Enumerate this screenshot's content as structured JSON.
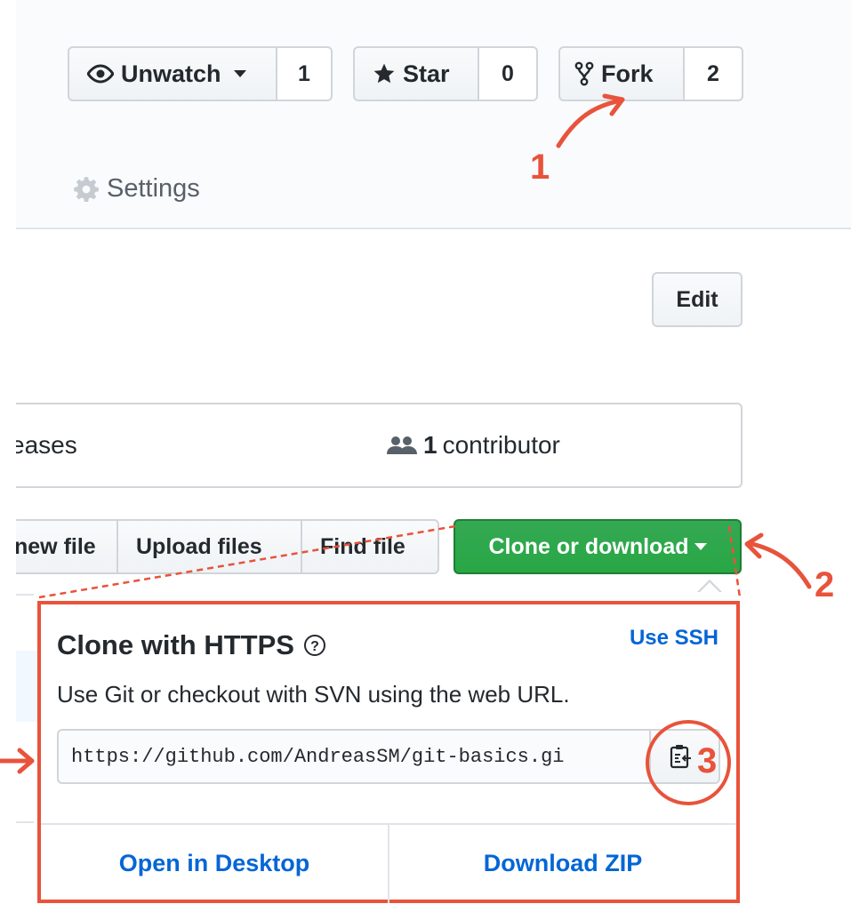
{
  "repo_actions": {
    "watch": {
      "label": "Unwatch",
      "count": "1"
    },
    "star": {
      "label": "Star",
      "count": "0"
    },
    "fork": {
      "label": "Fork",
      "count": "2"
    }
  },
  "tabs": {
    "settings": "Settings"
  },
  "edit_label": "Edit",
  "summary": {
    "releases": "eases",
    "contributor_count": "1",
    "contributor_label": "contributor"
  },
  "file_buttons": {
    "new_file": "new file",
    "upload": "Upload files",
    "find": "Find file"
  },
  "clone_button": "Clone or download",
  "clone_popup": {
    "title": "Clone with HTTPS",
    "use_ssh": "Use SSH",
    "description": "Use Git or checkout with SVN using the web URL.",
    "url": "https://github.com/AndreasSM/git-basics.gi",
    "open_desktop": "Open in Desktop",
    "download_zip": "Download ZIP"
  },
  "annotations": {
    "step1": "1",
    "step2": "2",
    "step3": "3"
  },
  "colors": {
    "annotation": "#e8533b",
    "clone_green": "#28a745",
    "link_blue": "#0366d6"
  }
}
